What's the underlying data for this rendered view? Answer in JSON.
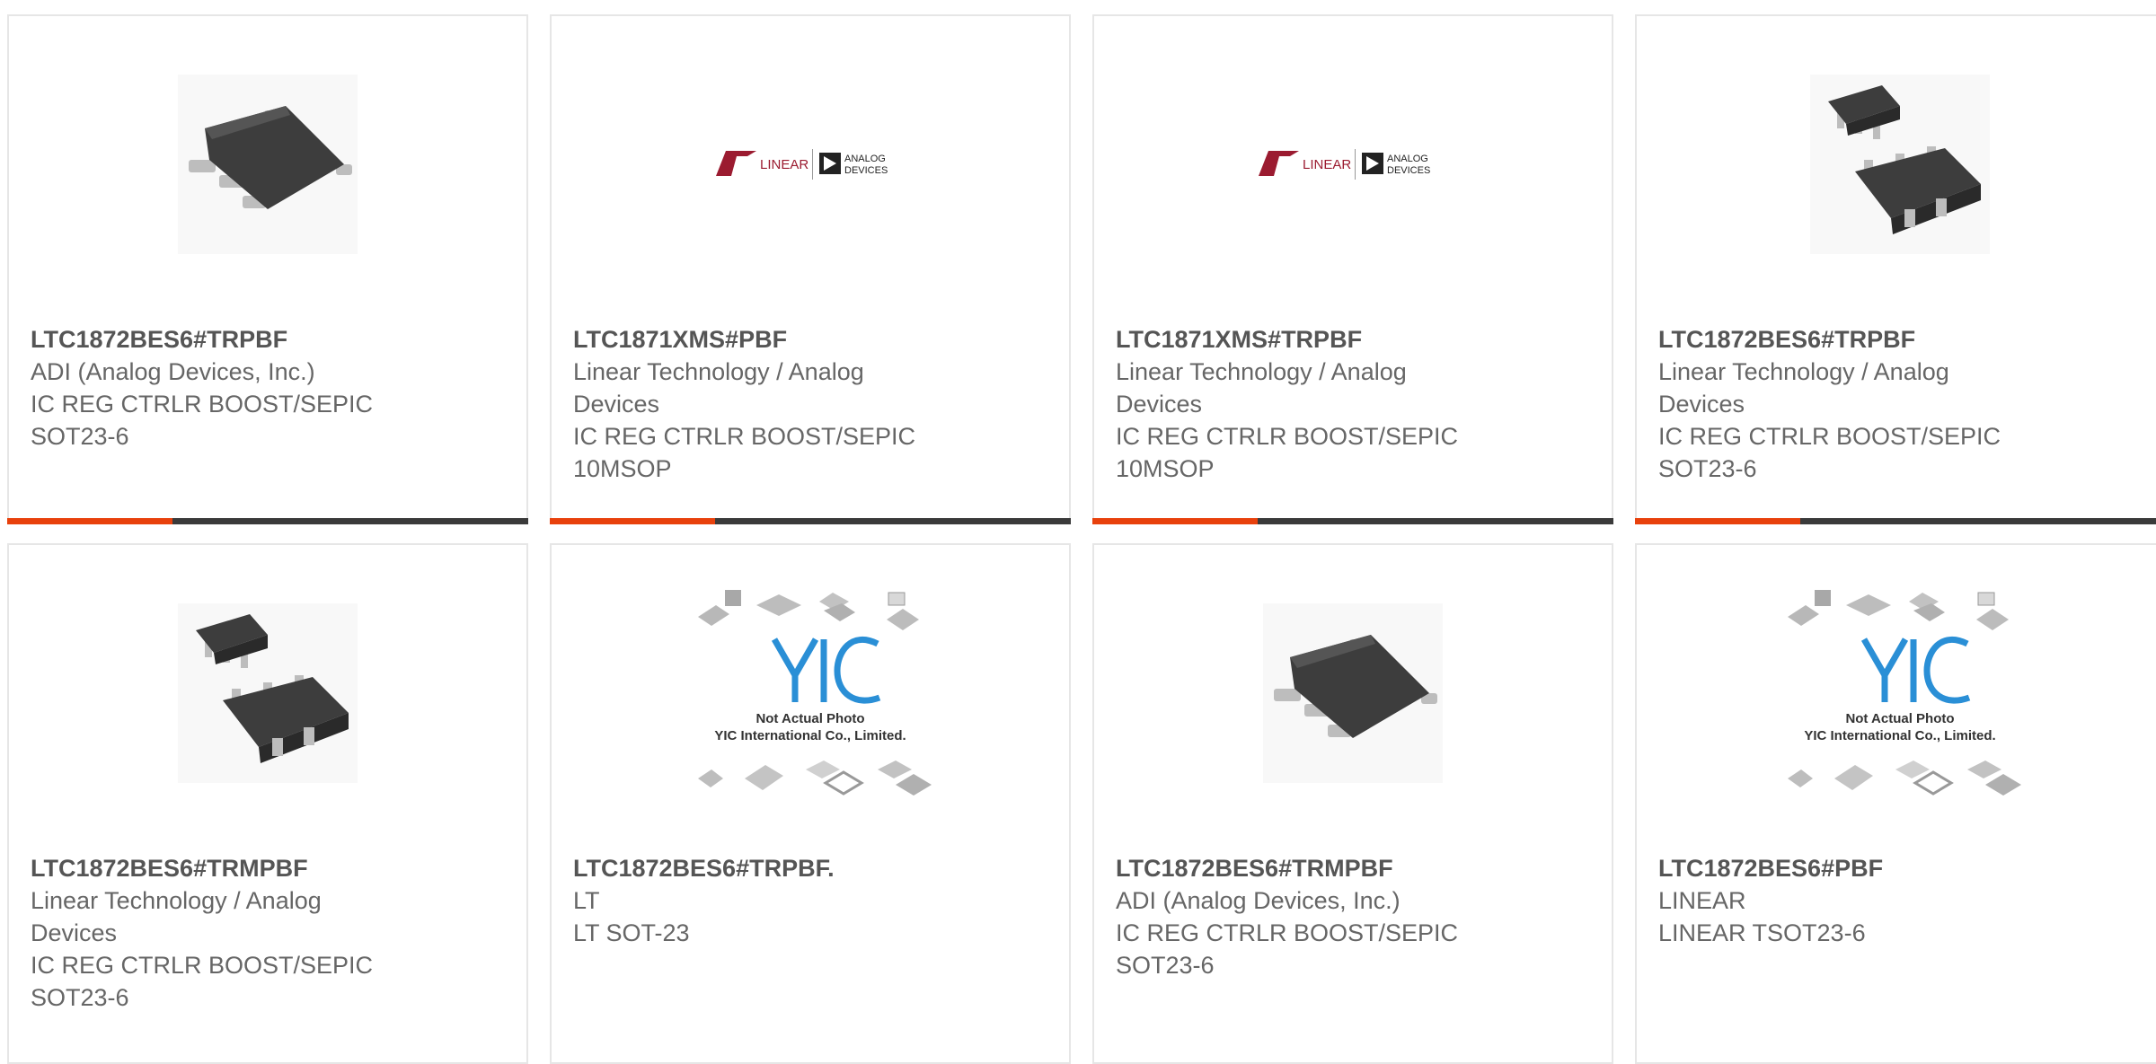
{
  "colors": {
    "accent": "#e8410c",
    "bar": "#3a3a3a",
    "border": "#e6e6e6",
    "text": "#666666"
  },
  "cards": [
    {
      "part": "LTC1872BES6#TRPBF",
      "lines": [
        "ADI (Analog Devices, Inc.)",
        "IC REG CTRLR BOOST/SEPIC SOT23-6"
      ],
      "image": "single-chip"
    },
    {
      "part": "LTC1871XMS#PBF",
      "lines": [
        "Linear Technology / Analog Devices",
        "IC REG CTRLR BOOST/SEPIC 10MSOP"
      ],
      "image": "brand-logo"
    },
    {
      "part": "LTC1871XMS#TRPBF",
      "lines": [
        "Linear Technology / Analog Devices",
        "IC REG CTRLR BOOST/SEPIC 10MSOP"
      ],
      "image": "brand-logo"
    },
    {
      "part": "LTC1872BES6#TRPBF",
      "lines": [
        "Linear Technology / Analog Devices",
        "IC REG CTRLR BOOST/SEPIC SOT23-6"
      ],
      "image": "double-chip"
    },
    {
      "part": "LTC1872BES6#TRMPBF",
      "lines": [
        "Linear Technology / Analog Devices",
        "IC REG CTRLR BOOST/SEPIC SOT23-6"
      ],
      "image": "double-chip"
    },
    {
      "part": "LTC1872BES6#TRPBF.",
      "lines": [
        "LT",
        "LT SOT-23"
      ],
      "image": "yic-placeholder"
    },
    {
      "part": "LTC1872BES6#TRMPBF",
      "lines": [
        "ADI (Analog Devices, Inc.)",
        "IC REG CTRLR BOOST/SEPIC SOT23-6"
      ],
      "image": "single-chip"
    },
    {
      "part": "LTC1872BES6#PBF",
      "lines": [
        "LINEAR",
        "LINEAR TSOT23-6"
      ],
      "image": "yic-placeholder"
    }
  ],
  "logo": {
    "linear": "LINEAR",
    "analog_line1": "ANALOG",
    "analog_line2": "DEVICES"
  },
  "placeholder": {
    "line1": "Not Actual Photo",
    "line2": "YIC International Co., Limited."
  }
}
